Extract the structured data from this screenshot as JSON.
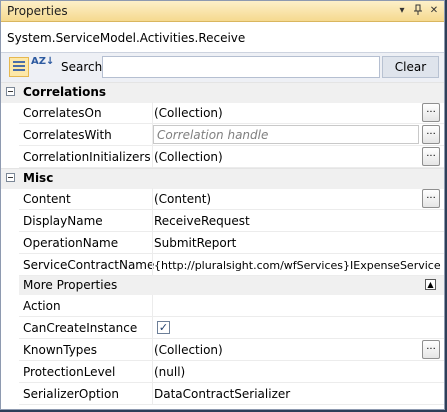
{
  "window": {
    "title": "Properties"
  },
  "titlebar": {
    "dropdown_icon": "▾",
    "pin_icon": "■",
    "close_icon": "✕"
  },
  "type_name": "System.ServiceModel.Activities.Receive",
  "toolbar": {
    "categorized_icon": "categorized-icon",
    "alphabetical_icon_text": "AZ↓",
    "search_label": "Search:",
    "search_value": "",
    "clear_label": "Clear"
  },
  "categories": [
    {
      "name": "Correlations",
      "rows": [
        {
          "name": "CorrelatesOn",
          "value": "(Collection)",
          "has_ellipsis": true
        },
        {
          "name": "CorrelatesWith",
          "placeholder": "Correlation handle",
          "has_ellipsis": true
        },
        {
          "name": "CorrelationInitializers",
          "value": "(Collection)",
          "has_ellipsis": true
        }
      ]
    },
    {
      "name": "Misc",
      "rows": [
        {
          "name": "Content",
          "value": "(Content)",
          "has_ellipsis": true
        },
        {
          "name": "DisplayName",
          "value": "ReceiveRequest"
        },
        {
          "name": "OperationName",
          "value": "SubmitReport"
        },
        {
          "name": "ServiceContractName",
          "value": "{http://pluralsight.com/wfServices}IExpenseService"
        }
      ]
    }
  ],
  "more_properties": {
    "label": "More Properties",
    "collapse_icon": "▲",
    "rows": [
      {
        "name": "Action",
        "value": ""
      },
      {
        "name": "CanCreateInstance",
        "checked": true,
        "check_glyph": "✓"
      },
      {
        "name": "KnownTypes",
        "value": "(Collection)",
        "has_ellipsis": true
      },
      {
        "name": "ProtectionLevel",
        "value": "(null)"
      },
      {
        "name": "SerializerOption",
        "value": "DataContractSerializer"
      }
    ]
  },
  "ellipsis_label": "...",
  "colors": {
    "title_bar": "#f5d98f",
    "frame": "#2e3f58",
    "category_bg": "#f0f0f0"
  }
}
